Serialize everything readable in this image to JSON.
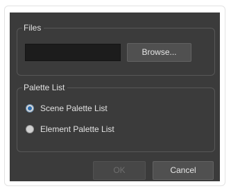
{
  "files_group": {
    "title": "Files",
    "path_value": "",
    "browse_label": "Browse..."
  },
  "palette_group": {
    "title": "Palette List",
    "options": [
      {
        "label": "Scene Palette List",
        "selected": true
      },
      {
        "label": "Element Palette List",
        "selected": false
      }
    ]
  },
  "buttons": {
    "ok_label": "OK",
    "ok_enabled": false,
    "cancel_label": "Cancel"
  }
}
